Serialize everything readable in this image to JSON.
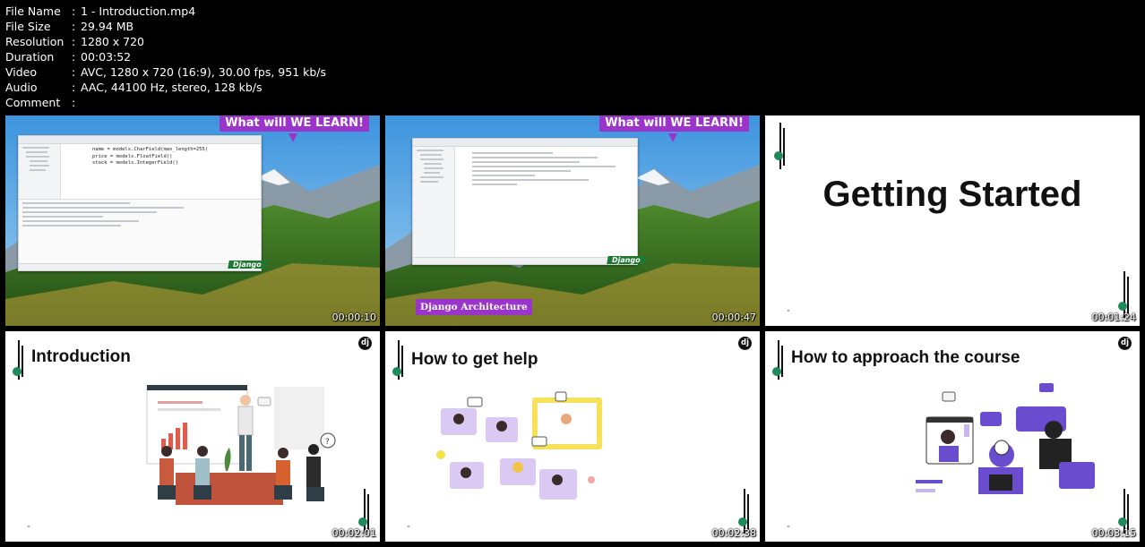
{
  "file_info": [
    {
      "key": "File Name",
      "value": "1 - Introduction.mp4"
    },
    {
      "key": "File Size",
      "value": "29.94 MB"
    },
    {
      "key": "Resolution",
      "value": "1280 x 720"
    },
    {
      "key": "Duration",
      "value": "00:03:52"
    },
    {
      "key": "Video",
      "value": "AVC, 1280 x 720 (16:9), 30.00 fps, 951 kb/s"
    },
    {
      "key": "Audio",
      "value": "AAC, 44100 Hz, stereo, 128 kb/s"
    },
    {
      "key": "Comment",
      "value": ""
    }
  ],
  "separator": ":",
  "thumbnails": [
    {
      "timestamp": "00:00:10",
      "banner": "What will WE LEARN!",
      "tag": "Django",
      "code_lines": [
        "name = models.CharField(max_length=255)",
        "price = models.FloatField()",
        "stock = models.IntegerField()"
      ]
    },
    {
      "timestamp": "00:00:47",
      "banner": "What will WE LEARN!",
      "tag": "Django",
      "caption": "Django Architecture"
    },
    {
      "timestamp": "00:01:24",
      "title": "Getting Started"
    },
    {
      "timestamp": "00:02:01",
      "title": "Introduction",
      "logo": "dj"
    },
    {
      "timestamp": "00:02:38",
      "title": "How to get help",
      "logo": "dj"
    },
    {
      "timestamp": "00:03:15",
      "title": "How to approach the course",
      "logo": "dj"
    }
  ],
  "colors": {
    "banner": "#9b34c9",
    "tag": "#1d7a30",
    "accent_green": "#1f8a5a",
    "sky": "#4aa3e6"
  },
  "icons": [
    "django-logo-icon",
    "decorative-lines-icon"
  ]
}
